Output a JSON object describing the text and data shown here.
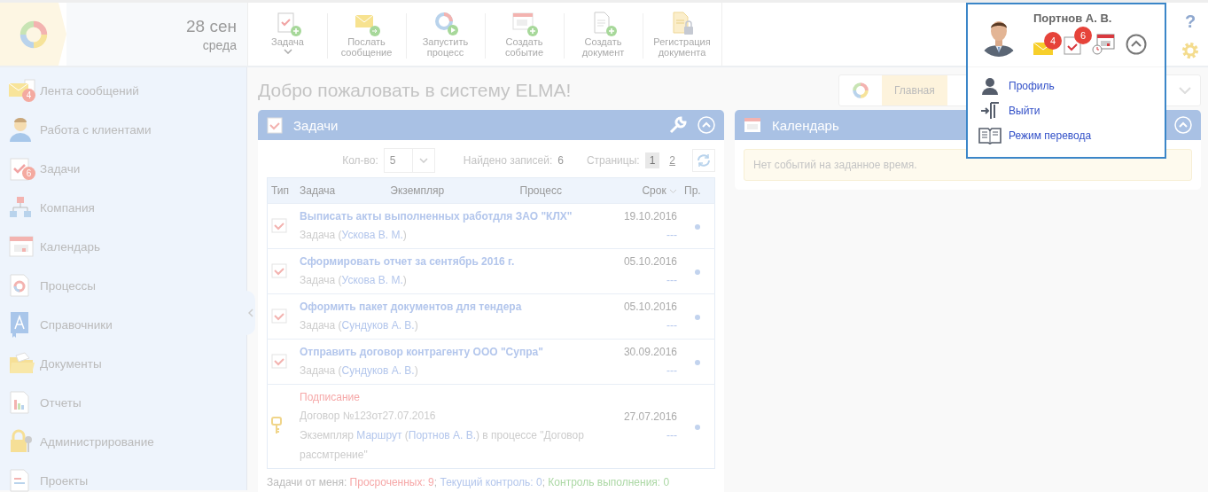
{
  "header": {
    "date": {
      "day": "28 сен",
      "weekday": "среда"
    },
    "toolbar": [
      {
        "label": "Задача",
        "kind": "task",
        "dropdown": true
      },
      {
        "label": "Послать сообщение",
        "kind": "message",
        "dropdown": false
      },
      {
        "label": "Запустить процесс",
        "kind": "process",
        "dropdown": false
      },
      {
        "label": "Создать событие",
        "kind": "event",
        "dropdown": false
      },
      {
        "label": "Создать документ",
        "kind": "document",
        "dropdown": false
      },
      {
        "label": "Регистрация документа",
        "kind": "register",
        "dropdown": false
      }
    ],
    "help": "?"
  },
  "sidebar": {
    "items": [
      {
        "label": "Лента сообщений",
        "kind": "mail",
        "badge": "4"
      },
      {
        "label": "Работа с клиентами",
        "kind": "person"
      },
      {
        "label": "Задачи",
        "kind": "task",
        "badge": "6"
      },
      {
        "label": "Компания",
        "kind": "org"
      },
      {
        "label": "Календарь",
        "kind": "calendar"
      },
      {
        "label": "Процессы",
        "kind": "process"
      },
      {
        "label": "Справочники",
        "kind": "book"
      },
      {
        "label": "Документы",
        "kind": "folder"
      },
      {
        "label": "Отчеты",
        "kind": "report"
      },
      {
        "label": "Администрирование",
        "kind": "lock"
      },
      {
        "label": "Проекты",
        "kind": "project"
      }
    ]
  },
  "page_title": "Добро пожаловать в систему ELMA!",
  "home_tabs": [
    {
      "label": "Главная",
      "selected": true
    }
  ],
  "tasks_panel": {
    "title": "Задачи",
    "count_label": "Кол-во:",
    "count_value": "5",
    "found_label": "Найдено записей:",
    "found_value": "6",
    "pages_label": "Страницы:",
    "pages": [
      {
        "label": "1",
        "selected": true
      },
      {
        "label": "2",
        "selected": false
      }
    ],
    "columns": [
      "Тип",
      "Задача",
      "Экземпляр",
      "Процесс",
      "Срок",
      "Пр."
    ],
    "rows": [
      {
        "kind": "task",
        "title": "Выписать акты выполненных работдля ЗАО \"КЛХ\"",
        "lines": [
          [
            {
              "text": "Задача (",
              "kind": "plain"
            },
            {
              "text": "Ускова В. М.",
              "kind": "link"
            },
            {
              "text": ")",
              "kind": "plain"
            }
          ]
        ],
        "date": "19.10.2016",
        "control": "---"
      },
      {
        "kind": "task",
        "title": "Сформировать отчет за сентябрь 2016 г.",
        "lines": [
          [
            {
              "text": "Задача (",
              "kind": "plain"
            },
            {
              "text": "Ускова В. М.",
              "kind": "link"
            },
            {
              "text": ")",
              "kind": "plain"
            }
          ]
        ],
        "date": "05.10.2016",
        "control": "---"
      },
      {
        "kind": "task",
        "title": "Оформить пакет документов для тендера",
        "lines": [
          [
            {
              "text": "Задача (",
              "kind": "plain"
            },
            {
              "text": "Сундуков А. В.",
              "kind": "link"
            },
            {
              "text": ")",
              "kind": "plain"
            }
          ]
        ],
        "date": "05.10.2016",
        "control": "---"
      },
      {
        "kind": "task",
        "title": "Отправить договор контрагенту ООО \"Супра\"",
        "lines": [
          [
            {
              "text": "Задача (",
              "kind": "plain"
            },
            {
              "text": "Сундуков А. В.",
              "kind": "link"
            },
            {
              "text": ")",
              "kind": "plain"
            }
          ]
        ],
        "date": "30.09.2016",
        "control": "---"
      },
      {
        "kind": "approval",
        "title": "Подписание",
        "lines": [
          [
            {
              "text": "Договор №123от27.07.2016",
              "kind": "plain"
            }
          ],
          [
            {
              "text": "Экземпляр ",
              "kind": "plain"
            },
            {
              "text": "Маршрут",
              "kind": "link"
            },
            {
              "text": " (",
              "kind": "plain"
            },
            {
              "text": "Портнов А. В.",
              "kind": "link"
            },
            {
              "text": ") в процессе \"Договор рассмтрение\"",
              "kind": "plain"
            }
          ]
        ],
        "date": "27.07.2016",
        "control": "---"
      }
    ],
    "footer": [
      {
        "text": "Задачи от меня: ",
        "kind": "plain"
      },
      {
        "text": "Просроченных: 9",
        "kind": "overdue"
      },
      {
        "text": "; ",
        "kind": "plain"
      },
      {
        "text": "Текущий контроль: 0",
        "kind": "current"
      },
      {
        "text": "; ",
        "kind": "plain"
      },
      {
        "text": "Контроль выполнения: 0",
        "kind": "done"
      }
    ]
  },
  "calendar_panel": {
    "title": "Календарь",
    "empty_message": "Нет событий на заданное время."
  },
  "user_menu": {
    "name": "Портнов А. В.",
    "indicators": [
      {
        "kind": "mail",
        "badge": "4"
      },
      {
        "kind": "tasks",
        "badge": "6"
      },
      {
        "kind": "calendar"
      }
    ],
    "items": [
      {
        "label": "Профиль",
        "kind": "user"
      },
      {
        "label": "Выйти",
        "kind": "exit"
      },
      {
        "label": "Режим перевода",
        "kind": "book"
      }
    ]
  }
}
